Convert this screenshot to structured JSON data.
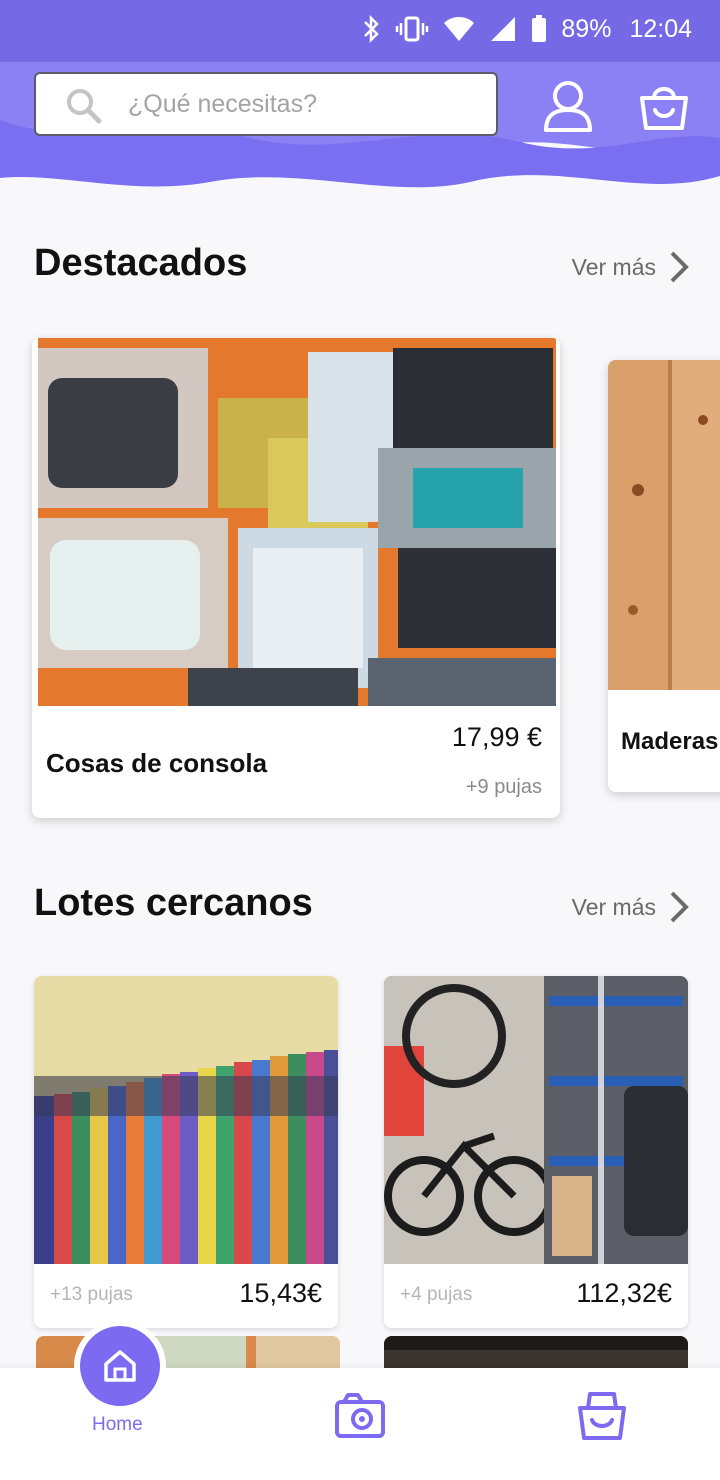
{
  "status_bar": {
    "battery": "89%",
    "time": "12:04"
  },
  "header": {
    "search_placeholder": "¿Qué necesitas?",
    "icons": [
      "search-icon",
      "user-icon",
      "shopping-bag-icon"
    ],
    "accent_color": "#7c6bf0"
  },
  "featured": {
    "title": "Destacados",
    "see_more": "Ver más",
    "items": [
      {
        "name": "Cosas de consola",
        "price": "17,99 €",
        "bids": "+9 pujas"
      },
      {
        "name": "Maderas"
      }
    ]
  },
  "nearby": {
    "title": "Lotes cercanos",
    "see_more": "Ver más",
    "items": [
      {
        "bids": "+13 pujas",
        "price": "15,43€"
      },
      {
        "bids": "+4 pujas",
        "price": "112,32€"
      }
    ]
  },
  "bottom_nav": {
    "home_label": "Home",
    "icons": [
      "home-icon",
      "camera-icon",
      "basket-icon"
    ]
  }
}
